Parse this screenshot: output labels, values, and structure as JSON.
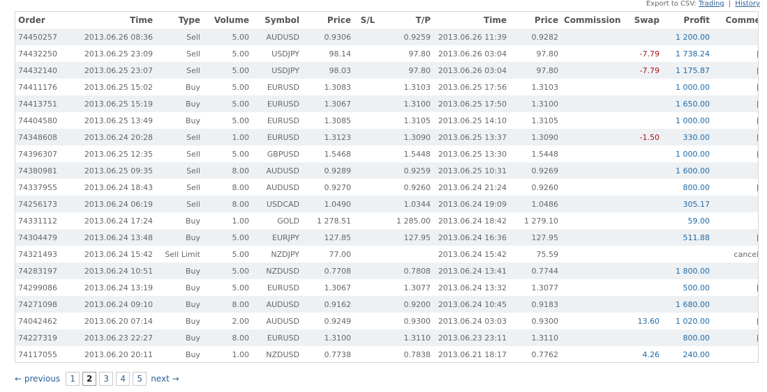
{
  "export": {
    "label": "Export to CSV:",
    "trading": "Trading",
    "separator": "|",
    "history": "History"
  },
  "columns": [
    "Order",
    "Time",
    "Type",
    "Volume",
    "Symbol",
    "Price",
    "S/L",
    "T/P",
    "Time",
    "Price",
    "Commission",
    "Swap",
    "Profit",
    "Comment"
  ],
  "rows": [
    [
      "74450257",
      "2013.06.26 08:36",
      "Sell",
      "5.00",
      "AUDUSD",
      "0.9306",
      "",
      "0.9259",
      "2013.06.26 11:39",
      "0.9282",
      "",
      "",
      "1 200.00",
      ""
    ],
    [
      "74432250",
      "2013.06.25 23:09",
      "Sell",
      "5.00",
      "USDJPY",
      "98.14",
      "",
      "97.80",
      "2013.06.26 03:04",
      "97.80",
      "",
      "-7.79",
      "1 738.24",
      "[tp]"
    ],
    [
      "74432140",
      "2013.06.25 23:07",
      "Sell",
      "5.00",
      "USDJPY",
      "98.03",
      "",
      "97.80",
      "2013.06.26 03:04",
      "97.80",
      "",
      "-7.79",
      "1 175.87",
      "[tp]"
    ],
    [
      "74411176",
      "2013.06.25 15:02",
      "Buy",
      "5.00",
      "EURUSD",
      "1.3083",
      "",
      "1.3103",
      "2013.06.25 17:56",
      "1.3103",
      "",
      "",
      "1 000.00",
      "[tp]"
    ],
    [
      "74413751",
      "2013.06.25 15:19",
      "Buy",
      "5.00",
      "EURUSD",
      "1.3067",
      "",
      "1.3100",
      "2013.06.25 17:50",
      "1.3100",
      "",
      "",
      "1 650.00",
      "[tp]"
    ],
    [
      "74404580",
      "2013.06.25 13:49",
      "Buy",
      "5.00",
      "EURUSD",
      "1.3085",
      "",
      "1.3105",
      "2013.06.25 14:10",
      "1.3105",
      "",
      "",
      "1 000.00",
      "[tp]"
    ],
    [
      "74348608",
      "2013.06.24 20:28",
      "Sell",
      "1.00",
      "EURUSD",
      "1.3123",
      "",
      "1.3090",
      "2013.06.25 13:37",
      "1.3090",
      "",
      "-1.50",
      "330.00",
      "[tp]"
    ],
    [
      "74396307",
      "2013.06.25 12:35",
      "Sell",
      "5.00",
      "GBPUSD",
      "1.5468",
      "",
      "1.5448",
      "2013.06.25 13:30",
      "1.5448",
      "",
      "",
      "1 000.00",
      "[tp]"
    ],
    [
      "74380981",
      "2013.06.25 09:35",
      "Sell",
      "8.00",
      "AUDUSD",
      "0.9289",
      "",
      "0.9259",
      "2013.06.25 10:31",
      "0.9269",
      "",
      "",
      "1 600.00",
      ""
    ],
    [
      "74337955",
      "2013.06.24 18:43",
      "Sell",
      "8.00",
      "AUDUSD",
      "0.9270",
      "",
      "0.9260",
      "2013.06.24 21:24",
      "0.9260",
      "",
      "",
      "800.00",
      "[tp]"
    ],
    [
      "74256173",
      "2013.06.24 06:19",
      "Sell",
      "8.00",
      "USDCAD",
      "1.0490",
      "",
      "1.0344",
      "2013.06.24 19:09",
      "1.0486",
      "",
      "",
      "305.17",
      ""
    ],
    [
      "74331112",
      "2013.06.24 17:24",
      "Buy",
      "1.00",
      "GOLD",
      "1 278.51",
      "",
      "1 285.00",
      "2013.06.24 18:42",
      "1 279.10",
      "",
      "",
      "59.00",
      ""
    ],
    [
      "74304479",
      "2013.06.24 13:48",
      "Buy",
      "5.00",
      "EURJPY",
      "127.85",
      "",
      "127.95",
      "2013.06.24 16:36",
      "127.95",
      "",
      "",
      "511.88",
      "[tp]"
    ],
    [
      "74321493",
      "2013.06.24 15:42",
      "Sell Limit",
      "5.00",
      "NZDJPY",
      "77.00",
      "",
      "",
      "2013.06.24 15:42",
      "75.59",
      "",
      "",
      "",
      "cancelled"
    ],
    [
      "74283197",
      "2013.06.24 10:51",
      "Buy",
      "5.00",
      "NZDUSD",
      "0.7708",
      "",
      "0.7808",
      "2013.06.24 13:41",
      "0.7744",
      "",
      "",
      "1 800.00",
      ""
    ],
    [
      "74299086",
      "2013.06.24 13:19",
      "Buy",
      "5.00",
      "EURUSD",
      "1.3067",
      "",
      "1.3077",
      "2013.06.24 13:32",
      "1.3077",
      "",
      "",
      "500.00",
      "[tp]"
    ],
    [
      "74271098",
      "2013.06.24 09:10",
      "Buy",
      "8.00",
      "AUDUSD",
      "0.9162",
      "",
      "0.9200",
      "2013.06.24 10:45",
      "0.9183",
      "",
      "",
      "1 680.00",
      ""
    ],
    [
      "74042462",
      "2013.06.20 07:14",
      "Buy",
      "2.00",
      "AUDUSD",
      "0.9249",
      "",
      "0.9300",
      "2013.06.24 03:03",
      "0.9300",
      "",
      "13.60",
      "1 020.00",
      "[tp]"
    ],
    [
      "74227319",
      "2013.06.23 22:27",
      "Buy",
      "8.00",
      "EURUSD",
      "1.3100",
      "",
      "1.3110",
      "2013.06.23 23:11",
      "1.3110",
      "",
      "",
      "800.00",
      "[tp]"
    ],
    [
      "74117055",
      "2013.06.20 20:11",
      "Buy",
      "1.00",
      "NZDUSD",
      "0.7738",
      "",
      "0.7838",
      "2013.06.21 18:17",
      "0.7762",
      "",
      "4.26",
      "240.00",
      ""
    ]
  ],
  "pagination": {
    "previous": "← previous",
    "next": "next →",
    "pages": [
      "1",
      "2",
      "3",
      "4",
      "5"
    ],
    "current": "2"
  },
  "colors": {
    "negative": "#a31515",
    "positive": "#1e6aa8",
    "link": "#2a5f9a",
    "row_alt": "#eef1f4"
  }
}
